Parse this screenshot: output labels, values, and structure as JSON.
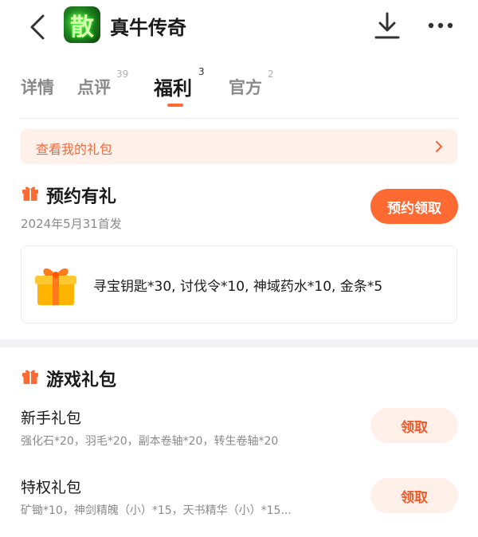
{
  "header": {
    "app_title": "真牛传奇",
    "app_icon_glyph": "散",
    "icons": {
      "back": "back-arrow-icon",
      "download": "download-icon",
      "more": "more-dots-icon"
    }
  },
  "tabs": [
    {
      "label": "详情",
      "count": ""
    },
    {
      "label": "点评",
      "count": "39"
    },
    {
      "label": "福利",
      "count": "3",
      "active": true
    },
    {
      "label": "官方",
      "count": "2"
    }
  ],
  "my_gift_bar": {
    "label": "查看我的礼包",
    "icon": "chevron-right-icon"
  },
  "reservation": {
    "title": "预约有礼",
    "date": "2024年5月31首发",
    "button": "预约领取",
    "rewards": "寻宝钥匙*30, 讨伐令*10, 神域药水*10, 金条*5"
  },
  "game_gifts": {
    "title": "游戏礼包",
    "packs": [
      {
        "name": "新手礼包",
        "items": "强化石*20，羽毛*20，副本卷轴*20，转生卷轴*20",
        "button": "领取"
      },
      {
        "name": "特权礼包",
        "items": "矿锄*10，神剑精魄（小）*15，天书精华（小）*15...",
        "button": "领取"
      }
    ]
  },
  "colors": {
    "accent": "#ff6a33",
    "accent_light": "#fff0ea",
    "accent_text": "#ee6a3d",
    "muted": "#8a8a8a"
  }
}
